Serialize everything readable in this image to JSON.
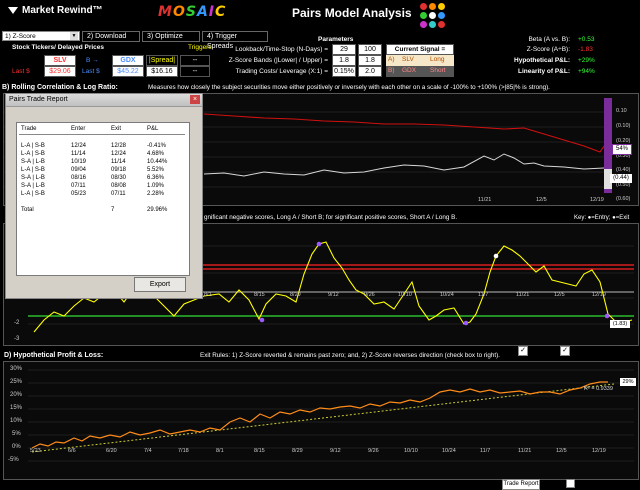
{
  "app": {
    "title": "Market Rewind™",
    "brand": "MOSAIC",
    "page_title": "Pairs Model Analysis"
  },
  "toolbar": {
    "selector": "1) Z-Score",
    "download": "2) Download",
    "optimize": "3) Optimize",
    "triggers": "4) Trigger Spreads"
  },
  "tickers": {
    "header": "Stock Tickers/ Delayed Prices",
    "triggers_label": "Triggers",
    "ticker_a": "SLV",
    "arrow_b": "B →",
    "ticker_b": "GDX",
    "spread_label": "|Spread|",
    "dash": "--",
    "last_a_label": "Last $",
    "price_a": "$29.06",
    "last_b_label": "Last $",
    "price_b": "$45.22",
    "spread_value": "$16.16",
    "dash2": "--"
  },
  "parameters": {
    "header": "Parameters",
    "rows": [
      {
        "label": "Lookback/Time-Stop (N-Days) =",
        "v1": "29",
        "v2": "100"
      },
      {
        "label": "Z-Score Bands (|Lower| / Upper) =",
        "v1": "1.8",
        "v2": "1.8"
      },
      {
        "label": "Trading Costs/ Leverage (X:1) =",
        "v1": "0.15%",
        "v2": "2.0"
      }
    ],
    "signal_header": "Current Signal = Long",
    "signal_a_tag": "A)",
    "signal_a_ticker": "SLV",
    "signal_a_action": "Long",
    "signal_b_tag": "B)",
    "signal_b_ticker": "GDX",
    "signal_b_action": "Short"
  },
  "stats": [
    {
      "label": "Beta (A vs. B):",
      "value": "+0.53",
      "color": "#33ff33"
    },
    {
      "label": "Z-Score (A÷B):",
      "value": "-1.83",
      "color": "#ff3030"
    },
    {
      "label": "Hypothetical P&L:",
      "value": "+29%",
      "color": "#33ff33"
    },
    {
      "label": "Linearity of P&L:",
      "value": "+94%",
      "color": "#33ff33"
    }
  ],
  "panel_b": {
    "title": "B) Rolling Correlation & Log Ratio:",
    "desc": "Measures how closely the subject securities move either positively or inversely with each other on a scale of -100% to +100% (>|85|% is strong).",
    "right_ticks": [
      "0.10",
      "(0.10)",
      "(0.20)",
      "(0.30)",
      "(0.40)",
      "(0.50)",
      "(0.60)"
    ],
    "badge_corr": "54%",
    "badge_ratio": "(0.44)",
    "x_ticks": [
      "11/21",
      "12/5",
      "12/19"
    ]
  },
  "panel_c": {
    "desc": "gnificant negative scores, Long A / Short B; for significant positive scores, Short A / Long B.",
    "key": "Key: ●=Entry; ●=Exit",
    "y_ticks": [
      "1",
      "0",
      "-1",
      "-2",
      "-3"
    ],
    "x_ticks": [
      "8/1",
      "8/15",
      "8/29",
      "9/12",
      "9/26",
      "10/10",
      "10/24",
      "11/7",
      "11/21",
      "12/5",
      "12/19"
    ],
    "badge": "(1.83)"
  },
  "panel_d": {
    "title": "D) Hypothetical Profit & Loss:",
    "rules": "Exit Rules:  1) Z-Score reverted & remains past zero; and, 2) Z-Score reverses direction (check box to right).",
    "check1": "✓",
    "check2": "✓",
    "y_ticks": [
      "30%",
      "25%",
      "20%",
      "15%",
      "10%",
      "5%",
      "0%",
      "-5%"
    ],
    "x_ticks": [
      "5/23",
      "6/6",
      "6/20",
      "7/4",
      "7/18",
      "8/1",
      "8/15",
      "8/29",
      "9/12",
      "9/26",
      "10/10",
      "10/24",
      "11/7",
      "11/21",
      "12/5",
      "12/19"
    ],
    "r2": "R² = 0.9339",
    "badge": "29%",
    "trade_report_button": "Trade Report"
  },
  "dialog": {
    "title": "Pairs Trade Report",
    "headers": [
      "Trade",
      "Enter",
      "Exit",
      "P&L"
    ],
    "rows": [
      [
        "L-A | S-B",
        "12/24",
        "12/28",
        "-0.41%"
      ],
      [
        "L-A | S-B",
        "11/14",
        "12/24",
        "4.68%"
      ],
      [
        "S-A | L-B",
        "10/19",
        "11/14",
        "10.44%"
      ],
      [
        "L-A | S-B",
        "09/04",
        "09/18",
        "5.52%"
      ],
      [
        "S-A | L-B",
        "08/16",
        "08/30",
        "6.36%"
      ],
      [
        "S-A | L-B",
        "07/11",
        "08/08",
        "1.09%"
      ],
      [
        "L-A | S-B",
        "05/23",
        "07/11",
        "2.28%"
      ]
    ],
    "total_label": "Total",
    "total_count": "7",
    "total_pnl": "29.96%",
    "export_label": "Export"
  },
  "colors": {
    "corr_line": "#d01010",
    "ratio_line": "#d8d8d8",
    "zscore_line": "#ffff00",
    "upper_band": "#ff2020",
    "lower_band": "#33dd33",
    "pnl_line": "#ff8c1a",
    "trend_line": "#cccc33"
  }
}
